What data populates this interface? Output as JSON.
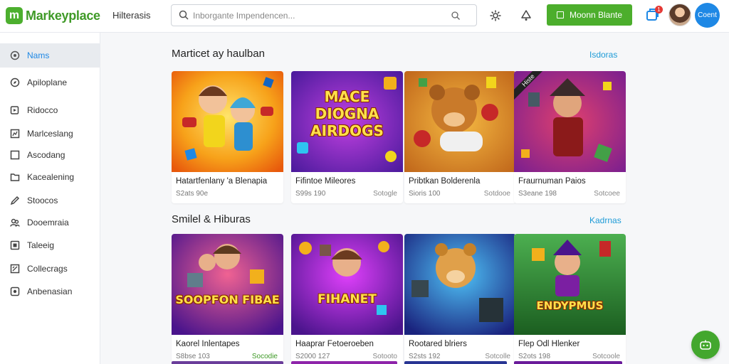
{
  "header": {
    "logo_letter": "m",
    "brand": "Markeyplace",
    "nav_link": "Hilterasis",
    "search_placeholder": "Inborgante Impendencen...",
    "cta_label": "Moonn Blante",
    "cart_badge": "1",
    "user_button": "Coent"
  },
  "sidebar": {
    "items": [
      {
        "label": "Nams",
        "icon": "home-icon",
        "active": true
      },
      {
        "label": "Apiloplane",
        "icon": "compass-icon"
      },
      {
        "label": "Ridocco",
        "icon": "video-icon"
      },
      {
        "label": "Marlceslang",
        "icon": "chart-icon"
      },
      {
        "label": "Ascodang",
        "icon": "square-icon"
      },
      {
        "label": "Kacealening",
        "icon": "folder-icon"
      },
      {
        "label": "Stoocos",
        "icon": "pencil-icon"
      },
      {
        "label": "Dooemraia",
        "icon": "users-icon"
      },
      {
        "label": "Taleeig",
        "icon": "tag-icon"
      },
      {
        "label": "Collecrags",
        "icon": "collection-icon"
      },
      {
        "label": "Anbenasian",
        "icon": "settings-icon"
      }
    ]
  },
  "sections": [
    {
      "title": "Marticet ay haulban",
      "see_all": "Isdoras",
      "cards": [
        {
          "title": "Hatartfenlany 'a Blenapia",
          "price": "S2ats 90e",
          "meta": "",
          "thumb_text": "",
          "tag": ""
        },
        {
          "title": "Fifintoe Mileores",
          "price": "S99s 190",
          "meta": "Sotogle",
          "thumb_text": "MACE DIOGNA AIRDOGS",
          "tag": ""
        },
        {
          "title": "Pribtkan Bolderenla",
          "price": "Sioris 100",
          "meta": "Sotdooe",
          "thumb_text": "",
          "tag": ""
        },
        {
          "title": "Fraurnuman Paios",
          "price": "S3eane 198",
          "meta": "Sotcoee",
          "thumb_text": "",
          "tag": "Histe"
        }
      ]
    },
    {
      "title": "Smilel & Hiburas",
      "see_all": "Kadrnas",
      "cards": [
        {
          "title": "Kaorel Inlentapes",
          "price": "S8bse 103",
          "meta": "Socodie",
          "thumb_text": "SOOPFON FIBAE",
          "tag": ""
        },
        {
          "title": "Haaprar Fetoeroeben",
          "price": "S2000 127",
          "meta": "Sotooto",
          "thumb_text": "FIHANET",
          "tag": ""
        },
        {
          "title": "Rootared blriers",
          "price": "S2sts 192",
          "meta": "Sotcolle",
          "thumb_text": "",
          "tag": ""
        },
        {
          "title": "Flep Odl Hlenker",
          "price": "S2ots 198",
          "meta": "Sotcoole",
          "thumb_text": "ENDYPMUS",
          "tag": ""
        }
      ]
    }
  ],
  "colors": {
    "brand_green": "#4cae2c",
    "accent_blue": "#1e88e5",
    "link_blue": "#1e9bd7"
  }
}
